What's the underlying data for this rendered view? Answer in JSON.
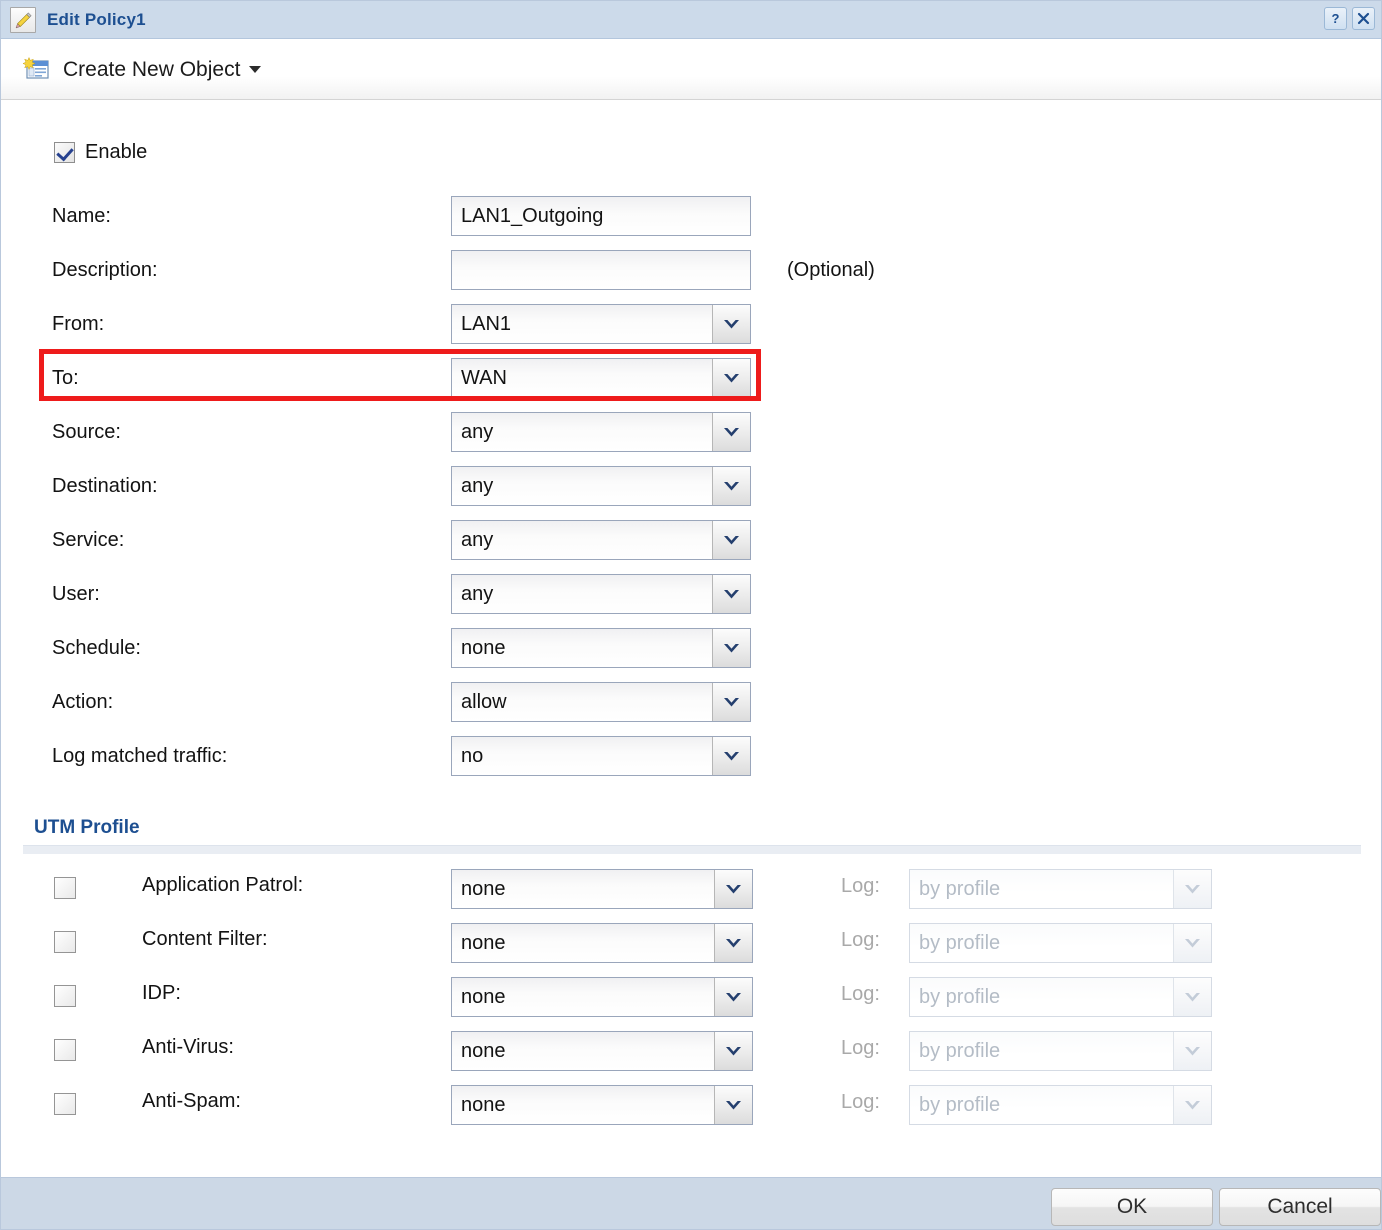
{
  "window": {
    "title": "Edit Policy1",
    "title_icon": "edit-pencil-icon",
    "help_button": "?",
    "close_button": "✕",
    "accent_color": "#1d4f91",
    "titlebar_color": "#ccdaea",
    "footer_color": "#ccd8e6",
    "highlight_color": "#ee1b1b"
  },
  "toolbar": {
    "create_new_object_label": "Create New Object",
    "create_new_object_icon": "new-object-icon",
    "caret_icon": "caret-down-icon"
  },
  "form": {
    "enable": {
      "label": "Enable",
      "checked": true
    },
    "fields": [
      {
        "label": "Name:",
        "type": "text",
        "value": "LAN1_Outgoing",
        "placeholder": ""
      },
      {
        "label": "Description:",
        "type": "text",
        "value": "",
        "placeholder": "",
        "suffix": "(Optional)"
      },
      {
        "label": "From:",
        "type": "select",
        "value": "LAN1"
      },
      {
        "label": "To:",
        "type": "select",
        "value": "WAN",
        "highlighted": true
      },
      {
        "label": "Source:",
        "type": "select",
        "value": "any"
      },
      {
        "label": "Destination:",
        "type": "select",
        "value": "any"
      },
      {
        "label": "Service:",
        "type": "select",
        "value": "any"
      },
      {
        "label": "User:",
        "type": "select",
        "value": "any"
      },
      {
        "label": "Schedule:",
        "type": "select",
        "value": "none"
      },
      {
        "label": "Action:",
        "type": "select",
        "value": "allow"
      },
      {
        "label": "Log matched traffic:",
        "type": "select",
        "value": "no"
      }
    ]
  },
  "utm": {
    "section_title": "UTM Profile",
    "log_label": "Log:",
    "rows": [
      {
        "label": "Application Patrol:",
        "checked": false,
        "profile": "none",
        "log": "by profile",
        "log_disabled": true
      },
      {
        "label": "Content Filter:",
        "checked": false,
        "profile": "none",
        "log": "by profile",
        "log_disabled": true
      },
      {
        "label": "IDP:",
        "checked": false,
        "profile": "none",
        "log": "by profile",
        "log_disabled": true
      },
      {
        "label": "Anti-Virus:",
        "checked": false,
        "profile": "none",
        "log": "by profile",
        "log_disabled": true
      },
      {
        "label": "Anti-Spam:",
        "checked": false,
        "profile": "none",
        "log": "by profile",
        "log_disabled": true
      }
    ]
  },
  "footer": {
    "ok_label": "OK",
    "cancel_label": "Cancel"
  }
}
